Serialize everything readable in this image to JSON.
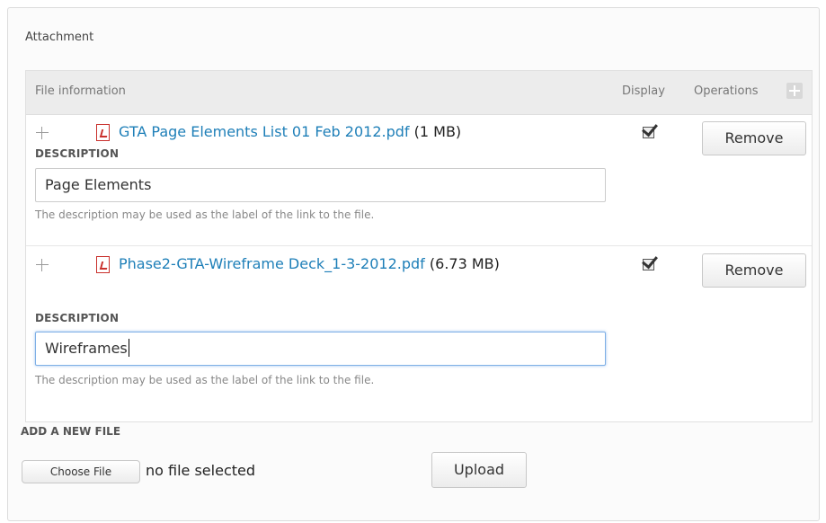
{
  "fieldset": {
    "legend": "Attachment"
  },
  "table": {
    "headers": {
      "file_information": "File information",
      "display": "Display",
      "operations": "Operations"
    },
    "operations_icon": "plus-square-icon",
    "rows": [
      {
        "drag_icon": "move-handle-icon",
        "file_icon": "pdf-file-icon",
        "file_name": "GTA Page Elements List 01 Feb 2012.pdf",
        "file_size": "(1 MB)",
        "description_label": "DESCRIPTION",
        "description_value": "Page Elements",
        "help_text": "The description may be used as the label of the link to the file.",
        "display_checked": true,
        "remove_label": "Remove"
      },
      {
        "drag_icon": "move-handle-icon",
        "file_icon": "pdf-file-icon",
        "file_name": "Phase2-GTA-Wireframe Deck_1-3-2012.pdf",
        "file_size": "(6.73 MB)",
        "description_label": "DESCRIPTION",
        "description_value": "Wireframes",
        "help_text": "The description may be used as the label of the link to the file.",
        "display_checked": true,
        "remove_label": "Remove"
      }
    ]
  },
  "add_file": {
    "label": "ADD A NEW FILE",
    "choose_label": "Choose File",
    "no_file_text": "no file selected",
    "upload_label": "Upload"
  },
  "colors": {
    "link": "#1e7fb8",
    "header_bg": "#ececec",
    "pdf_red": "#c9302c",
    "focus_border": "#7fb0e6"
  }
}
